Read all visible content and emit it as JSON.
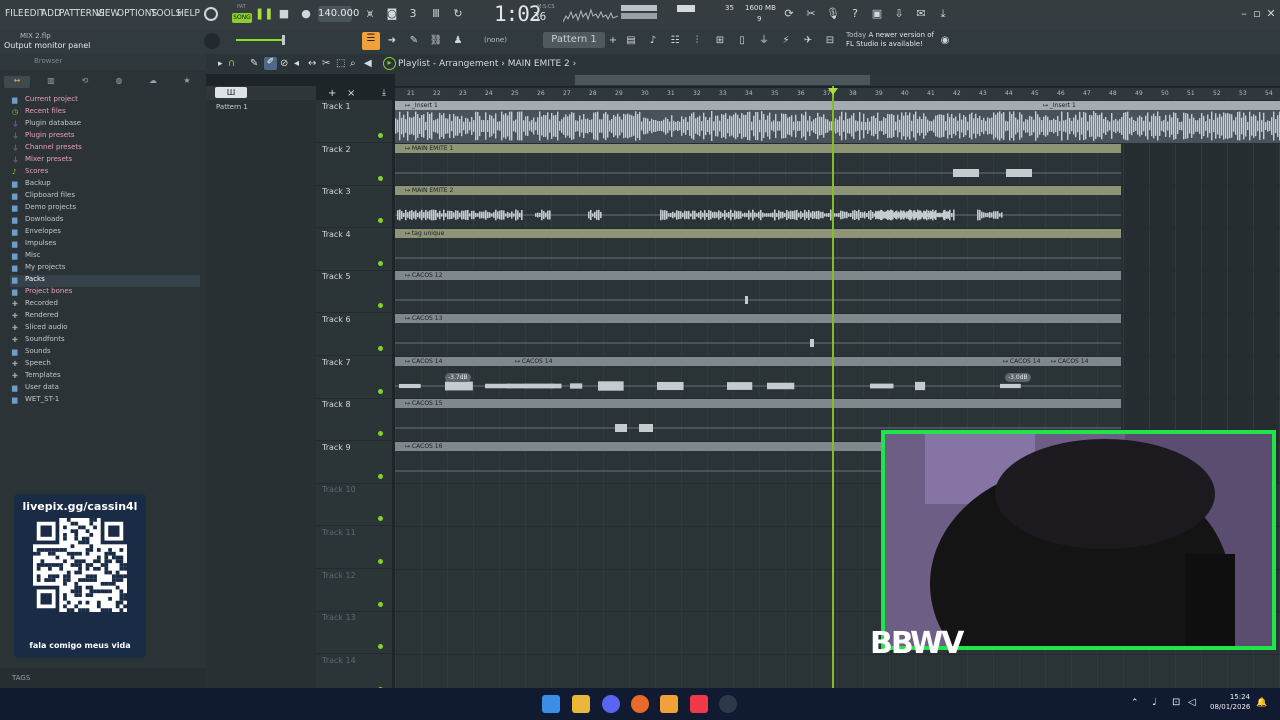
{
  "menu": [
    "FILE",
    "EDIT",
    "ADD",
    "PATTERNS",
    "VIEW",
    "OPTIONS",
    "TOOLS",
    "HELP"
  ],
  "transport": {
    "mode_label": "SONG",
    "pattern_label": "PAT",
    "tempo": "140.000",
    "time": "1:02",
    "time_ticks": "36",
    "time_unit": "M:S:CS"
  },
  "monitor": {
    "cpu": "35",
    "memory": "1600 MB",
    "polyphony": "9"
  },
  "file": {
    "name": "MIX 2.flp",
    "hint": "Output monitor panel"
  },
  "toolbar2": {
    "none_label": "(none)",
    "pattern_name": "Pattern 1",
    "update_today": "Today",
    "update_msg1": "A newer version of",
    "update_msg2": "FL Studio is available!"
  },
  "browser": {
    "title": "Browser",
    "items": [
      {
        "label": "Current project",
        "icon": "folder-icon",
        "style": "hl"
      },
      {
        "label": "Recent files",
        "icon": "clock-icon",
        "style": "hl"
      },
      {
        "label": "Plugin database",
        "icon": "plug-icon",
        "style": ""
      },
      {
        "label": "Plugin presets",
        "icon": "plug-icon",
        "style": "hl"
      },
      {
        "label": "Channel presets",
        "icon": "plug-icon",
        "style": "hl"
      },
      {
        "label": "Mixer presets",
        "icon": "plug-icon",
        "style": "hl"
      },
      {
        "label": "Scores",
        "icon": "note-icon",
        "style": "hl"
      },
      {
        "label": "Backup",
        "icon": "folder-icon",
        "style": ""
      },
      {
        "label": "Clipboard files",
        "icon": "folder-icon",
        "style": ""
      },
      {
        "label": "Demo projects",
        "icon": "folder-icon",
        "style": ""
      },
      {
        "label": "Downloads",
        "icon": "folder-icon",
        "style": ""
      },
      {
        "label": "Envelopes",
        "icon": "folder-icon",
        "style": ""
      },
      {
        "label": "Impulses",
        "icon": "folder-icon",
        "style": ""
      },
      {
        "label": "Misc",
        "icon": "folder-icon",
        "style": ""
      },
      {
        "label": "My projects",
        "icon": "folder-icon",
        "style": ""
      },
      {
        "label": "Packs",
        "icon": "folder-icon",
        "style": "sel"
      },
      {
        "label": "Project bones",
        "icon": "folder-icon",
        "style": "hl"
      },
      {
        "label": "Recorded",
        "icon": "plus-icon",
        "style": ""
      },
      {
        "label": "Rendered",
        "icon": "plus-icon",
        "style": ""
      },
      {
        "label": "Sliced audio",
        "icon": "plus-icon",
        "style": ""
      },
      {
        "label": "Soundfonts",
        "icon": "plus-icon",
        "style": ""
      },
      {
        "label": "Sounds",
        "icon": "folder-icon",
        "style": ""
      },
      {
        "label": "Speech",
        "icon": "plus-icon",
        "style": ""
      },
      {
        "label": "Templates",
        "icon": "plus-icon",
        "style": ""
      },
      {
        "label": "User data",
        "icon": "folder-icon",
        "style": ""
      },
      {
        "label": "WET_ST-1",
        "icon": "folder-icon",
        "style": ""
      }
    ],
    "tags_label": "TAGS"
  },
  "overlay": {
    "title": "livepix.gg/cassin4l",
    "footer": "fala comigo meus vida",
    "brand": "BBWV"
  },
  "pattern_list": {
    "button": "Ш",
    "item": "Pattern 1"
  },
  "playlist": {
    "title": "Playlist - Arrangement",
    "crumb": "MAIN EMITE 2",
    "bars": [
      "21",
      "22",
      "23",
      "24",
      "25",
      "26",
      "27",
      "28",
      "29",
      "30",
      "31",
      "32",
      "33",
      "34",
      "35",
      "36",
      "37",
      "38",
      "39",
      "40",
      "41",
      "42",
      "43",
      "44",
      "45",
      "46",
      "47",
      "48",
      "49",
      "50",
      "51",
      "52",
      "53",
      "54"
    ],
    "tracks": [
      "Track 1",
      "Track 2",
      "Track 3",
      "Track 4",
      "Track 5",
      "Track 6",
      "Track 7",
      "Track 8",
      "Track 9",
      "Track 10",
      "Track 11",
      "Track 12",
      "Track 13",
      "Track 14"
    ],
    "clips": [
      {
        "track": 0,
        "label": "_Insert 1",
        "color": "#a4acb1",
        "kind": "dense"
      },
      {
        "track": 0,
        "label": "_Insert 1",
        "color": "#a4acb1",
        "kind": "dense2"
      },
      {
        "track": 1,
        "label": "MAIN EMITE 1",
        "color": "#8e9476",
        "kind": "sparse"
      },
      {
        "track": 2,
        "label": "MAIN EMITE 2",
        "color": "#8e9476",
        "kind": "vocal"
      },
      {
        "track": 3,
        "label": "tag unique",
        "color": "#8e9476",
        "kind": "empty"
      },
      {
        "track": 4,
        "label": "CACOS 12",
        "color": "#7f888d",
        "kind": "dot"
      },
      {
        "track": 5,
        "label": "CACOS 13",
        "color": "#7f888d",
        "kind": "dot2"
      },
      {
        "track": 6,
        "label": "CACOS 14",
        "color": "#7f888d",
        "kind": "hits"
      },
      {
        "track": 7,
        "label": "CACOS 15",
        "color": "#7f888d",
        "kind": "small"
      },
      {
        "track": 8,
        "label": "CACOS 16",
        "color": "#7f888d",
        "kind": "empty"
      }
    ],
    "gain_labels": [
      "-3.7dB",
      "-3.0dB"
    ],
    "playhead_bar": "37"
  },
  "taskbar": {
    "time": "15:24",
    "date": "08/01/2026"
  }
}
